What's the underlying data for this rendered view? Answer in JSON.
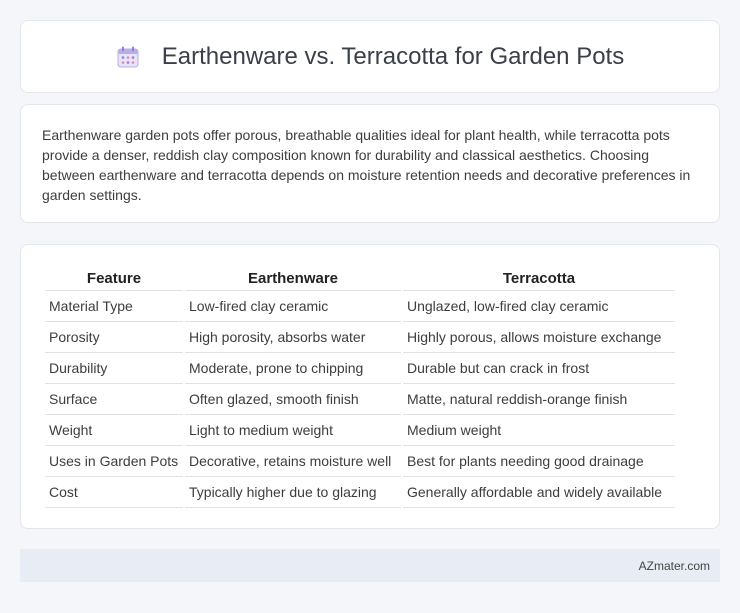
{
  "header": {
    "title": "Earthenware vs. Terracotta for Garden Pots",
    "icon": "calendar-icon"
  },
  "intro": {
    "text": "Earthenware garden pots offer porous, breathable qualities ideal for plant health, while terracotta pots provide a denser, reddish clay composition known for durability and classical aesthetics. Choosing between earthenware and terracotta depends on moisture retention needs and decorative preferences in garden settings."
  },
  "table": {
    "headers": [
      "Feature",
      "Earthenware",
      "Terracotta"
    ],
    "rows": [
      [
        "Material Type",
        "Low-fired clay ceramic",
        "Unglazed, low-fired clay ceramic"
      ],
      [
        "Porosity",
        "High porosity, absorbs water",
        "Highly porous, allows moisture exchange"
      ],
      [
        "Durability",
        "Moderate, prone to chipping",
        "Durable but can crack in frost"
      ],
      [
        "Surface",
        "Often glazed, smooth finish",
        "Matte, natural reddish-orange finish"
      ],
      [
        "Weight",
        "Light to medium weight",
        "Medium weight"
      ],
      [
        "Uses in Garden Pots",
        "Decorative, retains moisture well",
        "Best for plants needing good drainage"
      ],
      [
        "Cost",
        "Typically higher due to glazing",
        "Generally affordable and widely available"
      ]
    ]
  },
  "footer": {
    "brand": "AZmater.com"
  },
  "colors": {
    "page_background": "#f4f6fa",
    "footer_background": "#e8edf5",
    "icon_accent": "#8b7fd6"
  }
}
